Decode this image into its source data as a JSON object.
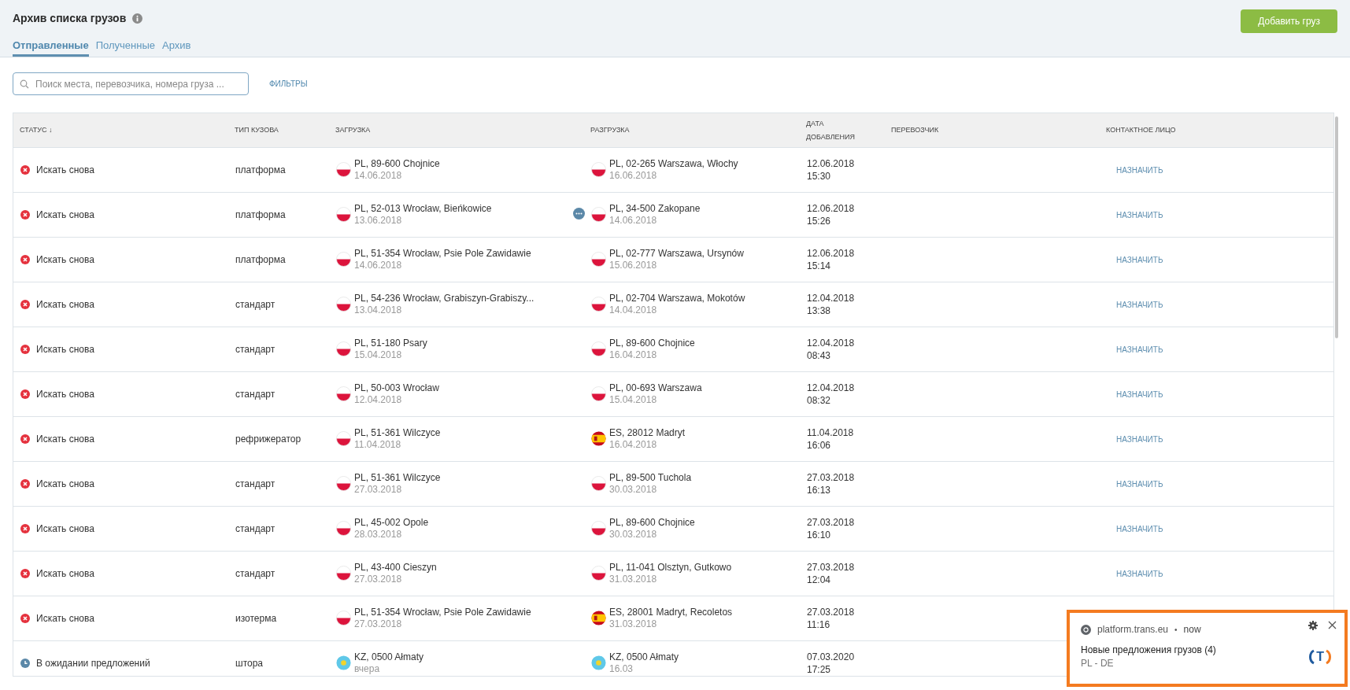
{
  "header": {
    "title": "Архив списка грузов",
    "add_button": "Добавить груз"
  },
  "tabs": [
    {
      "label": "Отправленные",
      "selected": true
    },
    {
      "label": "Полученные",
      "selected": false
    },
    {
      "label": "Архив",
      "selected": false
    }
  ],
  "search": {
    "placeholder": "Поиск места, перевозчика, номера груза ..."
  },
  "filters_link": "ФИЛЬТРЫ",
  "table": {
    "columns": [
      "СТАТУС ↓",
      "ТИП КУЗОВА",
      "ЗАГРУЗКА",
      "РАЗГРУЗКА",
      "ДАТА ДОБАВЛЕНИЯ",
      "ПЕРЕВОЗЧИК",
      "КОНТАКТНОЕ ЛИЦО"
    ],
    "rows": [
      {
        "status": {
          "kind": "retry",
          "text": "Искать снова"
        },
        "body": "платформа",
        "loading": {
          "kind": "pl",
          "place": "PL, 89-600 Chojnice",
          "date": "14.06.2018",
          "has_more": false
        },
        "unloading": {
          "kind": "pl",
          "place": "PL, 02-265 Warszawa, Włochy",
          "date": "16.06.2018"
        },
        "added_date": "12.06.2018",
        "added_time": "15:30",
        "assign": "НАЗНАЧИТЬ"
      },
      {
        "status": {
          "kind": "retry",
          "text": "Искать снова"
        },
        "body": "платформа",
        "loading": {
          "kind": "pl",
          "place": "PL, 52-013 Wrocław, Bieńkowice",
          "date": "13.06.2018",
          "has_more": true
        },
        "unloading": {
          "kind": "pl",
          "place": "PL, 34-500 Zakopane",
          "date": "14.06.2018"
        },
        "added_date": "12.06.2018",
        "added_time": "15:26",
        "assign": "НАЗНАЧИТЬ"
      },
      {
        "status": {
          "kind": "retry",
          "text": "Искать снова"
        },
        "body": "платформа",
        "loading": {
          "kind": "pl",
          "place": "PL, 51-354 Wrocław, Psie Pole Zawidawie",
          "date": "14.06.2018",
          "has_more": false
        },
        "unloading": {
          "kind": "pl",
          "place": "PL, 02-777 Warszawa, Ursynów",
          "date": "15.06.2018"
        },
        "added_date": "12.06.2018",
        "added_time": "15:14",
        "assign": "НАЗНАЧИТЬ"
      },
      {
        "status": {
          "kind": "retry",
          "text": "Искать снова"
        },
        "body": "стандарт",
        "loading": {
          "kind": "pl",
          "place": "PL, 54-236 Wrocław, Grabiszyn-Grabiszy...",
          "date": "13.04.2018",
          "has_more": false
        },
        "unloading": {
          "kind": "pl",
          "place": "PL, 02-704 Warszawa, Mokotów",
          "date": "14.04.2018"
        },
        "added_date": "12.04.2018",
        "added_time": "13:38",
        "assign": "НАЗНАЧИТЬ"
      },
      {
        "status": {
          "kind": "retry",
          "text": "Искать снова"
        },
        "body": "стандарт",
        "loading": {
          "kind": "pl",
          "place": "PL, 51-180 Psary",
          "date": "15.04.2018",
          "has_more": false
        },
        "unloading": {
          "kind": "pl",
          "place": "PL, 89-600 Chojnice",
          "date": "16.04.2018"
        },
        "added_date": "12.04.2018",
        "added_time": "08:43",
        "assign": "НАЗНАЧИТЬ"
      },
      {
        "status": {
          "kind": "retry",
          "text": "Искать снова"
        },
        "body": "стандарт",
        "loading": {
          "kind": "pl",
          "place": "PL, 50-003 Wrocław",
          "date": "12.04.2018",
          "has_more": false
        },
        "unloading": {
          "kind": "pl",
          "place": "PL, 00-693 Warszawa",
          "date": "15.04.2018"
        },
        "added_date": "12.04.2018",
        "added_time": "08:32",
        "assign": "НАЗНАЧИТЬ"
      },
      {
        "status": {
          "kind": "retry",
          "text": "Искать снова"
        },
        "body": "рефрижератор",
        "loading": {
          "kind": "pl",
          "place": "PL, 51-361 Wilczyce",
          "date": "11.04.2018",
          "has_more": false
        },
        "unloading": {
          "kind": "es",
          "place": "ES, 28012 Madryt",
          "date": "16.04.2018"
        },
        "added_date": "11.04.2018",
        "added_time": "16:06",
        "assign": "НАЗНАЧИТЬ"
      },
      {
        "status": {
          "kind": "retry",
          "text": "Искать снова"
        },
        "body": "стандарт",
        "loading": {
          "kind": "pl",
          "place": "PL, 51-361 Wilczyce",
          "date": "27.03.2018",
          "has_more": false
        },
        "unloading": {
          "kind": "pl",
          "place": "PL, 89-500 Tuchola",
          "date": "30.03.2018"
        },
        "added_date": "27.03.2018",
        "added_time": "16:13",
        "assign": "НАЗНАЧИТЬ"
      },
      {
        "status": {
          "kind": "retry",
          "text": "Искать снова"
        },
        "body": "стандарт",
        "loading": {
          "kind": "pl",
          "place": "PL, 45-002 Opole",
          "date": "28.03.2018",
          "has_more": false
        },
        "unloading": {
          "kind": "pl",
          "place": "PL, 89-600 Chojnice",
          "date": "30.03.2018"
        },
        "added_date": "27.03.2018",
        "added_time": "16:10",
        "assign": "НАЗНАЧИТЬ"
      },
      {
        "status": {
          "kind": "retry",
          "text": "Искать снова"
        },
        "body": "стандарт",
        "loading": {
          "kind": "pl",
          "place": "PL, 43-400 Cieszyn",
          "date": "27.03.2018",
          "has_more": false
        },
        "unloading": {
          "kind": "pl",
          "place": "PL, 11-041 Olsztyn, Gutkowo",
          "date": "31.03.2018"
        },
        "added_date": "27.03.2018",
        "added_time": "12:04",
        "assign": "НАЗНАЧИТЬ"
      },
      {
        "status": {
          "kind": "retry",
          "text": "Искать снова"
        },
        "body": "изотерма",
        "loading": {
          "kind": "pl",
          "place": "PL, 51-354 Wrocław, Psie Pole Zawidawie",
          "date": "27.03.2018",
          "has_more": false
        },
        "unloading": {
          "kind": "es",
          "place": "ES, 28001 Madryt, Recoletos",
          "date": "31.03.2018"
        },
        "added_date": "27.03.2018",
        "added_time": "11:16"
      },
      {
        "status": {
          "kind": "waiting",
          "text": "В ожидании предложений"
        },
        "body": "штора",
        "loading": {
          "kind": "kz",
          "place": "KZ, 0500 Ałmaty",
          "date": "вчера",
          "has_more": false
        },
        "unloading": {
          "kind": "kz",
          "place": "KZ, 0500 Ałmaty",
          "date": "16.03"
        },
        "added_date": "07.03.2020",
        "added_time": "17:25"
      }
    ]
  },
  "notification": {
    "source": "platform.trans.eu",
    "separator": "•",
    "time": "now",
    "title": "Новые предложения грузов (4)",
    "body": "PL - DE",
    "logo_text": "T"
  }
}
